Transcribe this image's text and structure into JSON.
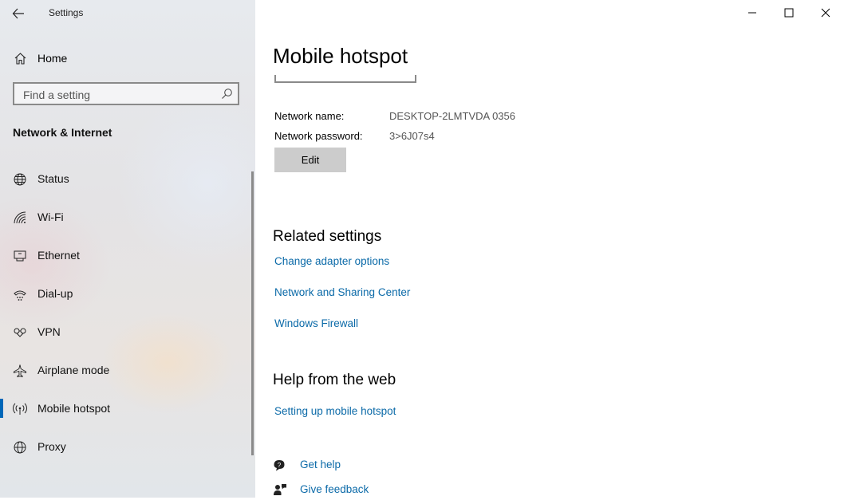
{
  "app_title": "Settings",
  "sidebar": {
    "home_label": "Home",
    "search_placeholder": "Find a setting",
    "section_title": "Network & Internet",
    "items": [
      {
        "label": "Status",
        "icon": "globe-network-icon"
      },
      {
        "label": "Wi-Fi",
        "icon": "wifi-icon"
      },
      {
        "label": "Ethernet",
        "icon": "ethernet-icon"
      },
      {
        "label": "Dial-up",
        "icon": "dialup-icon"
      },
      {
        "label": "VPN",
        "icon": "vpn-icon"
      },
      {
        "label": "Airplane mode",
        "icon": "airplane-icon"
      },
      {
        "label": "Mobile hotspot",
        "icon": "hotspot-icon",
        "selected": true
      },
      {
        "label": "Proxy",
        "icon": "globe-icon"
      }
    ]
  },
  "main": {
    "page_title": "Mobile hotspot",
    "network_name_label": "Network name:",
    "network_name_value": "DESKTOP-2LMTVDA 0356",
    "network_password_label": "Network password:",
    "network_password_value": "3>6J07s4",
    "edit_label": "Edit",
    "related_title": "Related settings",
    "related_links": [
      "Change adapter options",
      "Network and Sharing Center",
      "Windows Firewall"
    ],
    "help_title": "Help from the web",
    "help_links": [
      "Setting up mobile hotspot"
    ],
    "get_help_label": "Get help",
    "give_feedback_label": "Give feedback"
  },
  "colors": {
    "accent": "#0067b8",
    "link": "#0b6aa8",
    "button_bg": "#cccccc"
  }
}
